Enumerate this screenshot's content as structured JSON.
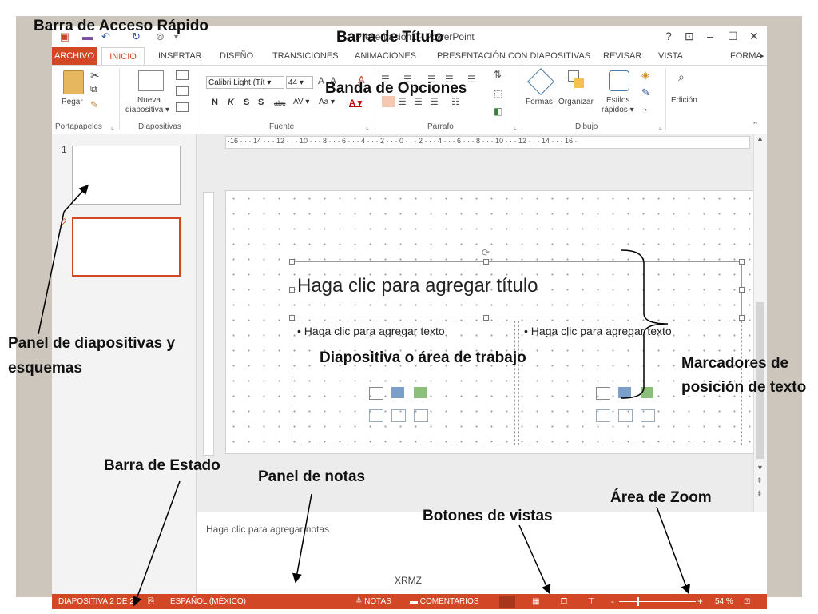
{
  "window": {
    "title": "Presentación1 - PowerPoint",
    "controls": {
      "help": "?",
      "ribbon_opts": "⊡",
      "minimize": "–",
      "restore": "☐",
      "close": "✕"
    }
  },
  "tabs": [
    "ARCHIVO",
    "INICIO",
    "INSERTAR",
    "DISEÑO",
    "TRANSICIONES",
    "ANIMACIONES",
    "PRESENTACIÓN CON DIAPOSITIVAS",
    "REVISAR",
    "VISTA",
    "FORMA"
  ],
  "ribbon": {
    "pegar": "Pegar",
    "nueva1": "Nueva",
    "nueva2": "diapositiva ▾",
    "font_name": "Calibri Light (Tít ▾",
    "font_size": "44 ▾",
    "fmt_buttons": [
      "N",
      "K",
      "S",
      "S",
      "abc",
      "AV ▾",
      "Aa ▾",
      "A ▾"
    ],
    "formas": "Formas",
    "organizar": "Organizar",
    "estilos1": "Estilos",
    "estilos2": "rápidos ▾",
    "edicion": "Edición",
    "groups": [
      "Portapapeles",
      "Diapositivas",
      "Fuente",
      "Párrafo",
      "Dibujo"
    ]
  },
  "ruler": {
    "h_ticks": "·16 · · · 14 · · · 12 · · · 10 · · · 8 · · · 6 · · · 4 · · · 2 · · · 0 · · · 2 · · · 4 · · · 6 · · · 8 · · · 10 · · · 12 · · · 14 · · · 16 ·"
  },
  "slides": [
    {
      "number": "1"
    },
    {
      "number": "2"
    }
  ],
  "slide": {
    "title_placeholder": "Haga clic para agregar título",
    "left_text": "• Haga clic para agregar texto",
    "right_text": "• Haga clic para agregar texto"
  },
  "notes": {
    "placeholder": "Haga clic para agregar notas",
    "watermark": "XRMZ"
  },
  "status": {
    "slide_pos": "DIAPOSITIVA 2 DE 2",
    "language": "ESPAÑOL (MÉXICO)",
    "notas": "≜ NOTAS",
    "comentarios": "▬ COMENTARIOS",
    "zoom_minus": "-",
    "zoom_plus": "+",
    "zoom": "54 %"
  },
  "annotations": {
    "quick_access": "Barra de Acceso Rápido",
    "title_bar": "Barra de Título",
    "ribbon": "Banda de Opciones",
    "slide_panel_1": "Panel de diapositivas y",
    "slide_panel_2": "esquemas",
    "work_area": "Diapositiva o área de trabajo",
    "placeholders_1": "Marcadores de",
    "placeholders_2": "posición de texto",
    "status_bar": "Barra de Estado",
    "notes_panel": "Panel de notas",
    "views": "Botones de vistas",
    "zoom": "Área de Zoom"
  },
  "colors": {
    "accent": "#d24726",
    "frame": "#cdc6bd"
  }
}
